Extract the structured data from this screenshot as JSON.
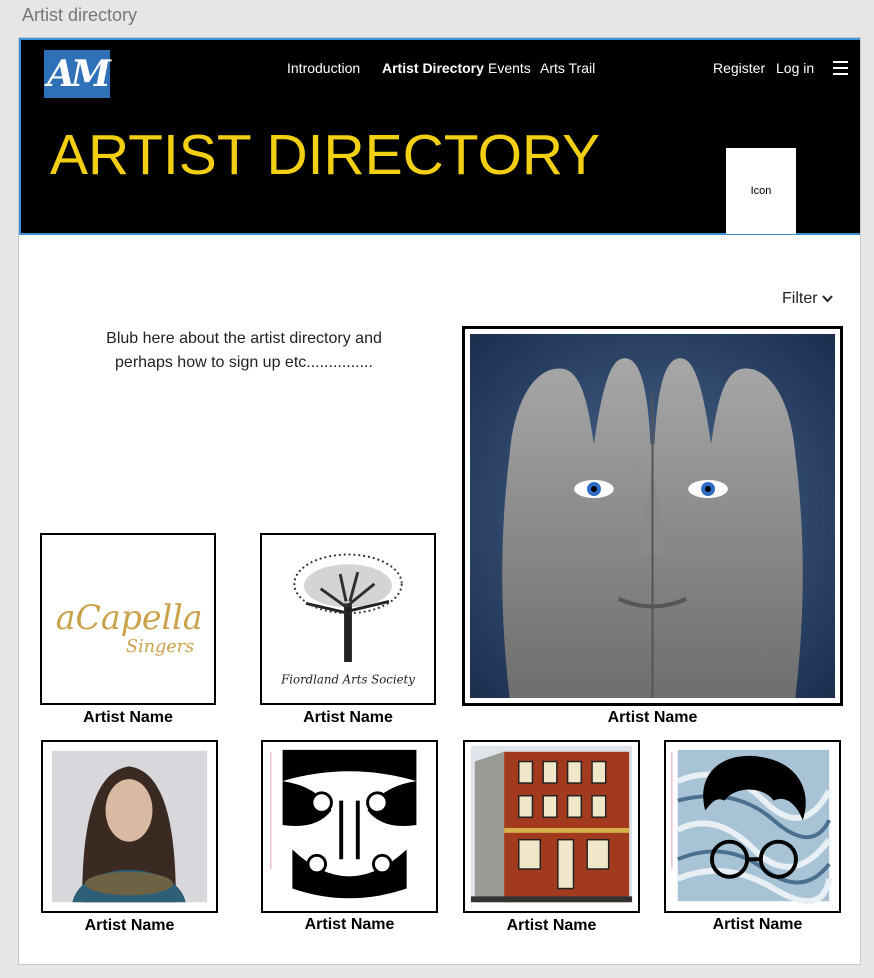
{
  "window": {
    "title": "Artist directory"
  },
  "header": {
    "logo_text": "AM",
    "nav": [
      {
        "label": "Introduction"
      },
      {
        "label": "Artist Directory",
        "active": true
      },
      {
        "label": "Events"
      },
      {
        "label": "Arts Trail"
      }
    ],
    "register_label": "Register",
    "login_label": "Log in",
    "hero_title": "ARTIST DIRECTORY",
    "icon_placeholder": "Icon"
  },
  "filter": {
    "label": "Filter",
    "chevron": "⌄"
  },
  "blurb": "Blub here about the artist directory and perhaps how to sign up etc...............",
  "artists": [
    {
      "name": "Artist Name",
      "image": "a-capella-singers-logo",
      "logo_lines": [
        "aCapella",
        "Singers"
      ]
    },
    {
      "name": "Artist Name",
      "image": "fiordland-arts-society-tree-logo",
      "logo_lines": [
        "Fiordland Arts Society"
      ]
    },
    {
      "name": "Artist Name",
      "image": "hands-face-painting"
    },
    {
      "name": "Artist Name",
      "image": "woman-landscape-painting"
    },
    {
      "name": "Artist Name",
      "image": "maori-moko-mask-print"
    },
    {
      "name": "Artist Name",
      "image": "brick-building-sketch"
    },
    {
      "name": "Artist Name",
      "image": "man-with-glasses-swirl-portrait"
    }
  ],
  "colors": {
    "header_bg": "#000000",
    "hero_title": "#f2cf13",
    "logo_bg": "#2f71b8",
    "header_border": "#3a8fd6"
  }
}
